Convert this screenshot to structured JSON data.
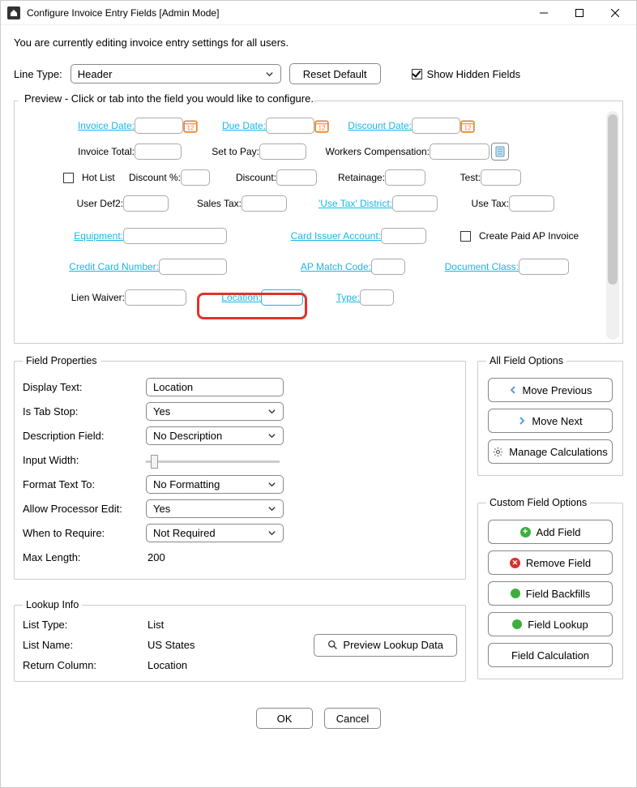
{
  "window": {
    "title": "Configure Invoice Entry Fields [Admin Mode]"
  },
  "intro": "You are currently editing invoice entry settings for all users.",
  "row1": {
    "line_type_label": "Line Type:",
    "line_type_value": "Header",
    "reset_label": "Reset Default",
    "show_hidden_label": "Show Hidden Fields",
    "show_hidden_checked": true
  },
  "preview": {
    "legend": "Preview - Click or tab into the field you would like to configure.",
    "fields": {
      "invoice_date": "Invoice Date:",
      "due_date": "Due Date:",
      "discount_date": "Discount Date:",
      "invoice_total": "Invoice Total:",
      "set_to_pay": "Set to Pay:",
      "workers_comp": "Workers Compensation:",
      "hot_list": "Hot List",
      "discount_pct": "Discount %:",
      "discount": "Discount:",
      "retainage": "Retainage:",
      "test": "Test:",
      "user_def2": "User Def2:",
      "sales_tax": "Sales Tax:",
      "use_tax_district": "'Use Tax' District:",
      "use_tax": "Use Tax:",
      "equipment": "Equipment:",
      "card_issuer": "Card Issuer Account:",
      "create_paid": "Create Paid AP Invoice",
      "cc_number": "Credit Card Number:",
      "ap_match": "AP Match Code:",
      "doc_class": "Document Class:",
      "lien_waiver": "Lien Waiver:",
      "location": "Location:",
      "type": "Type:"
    }
  },
  "field_props": {
    "legend": "Field Properties",
    "display_text_label": "Display Text:",
    "display_text_value": "Location",
    "is_tab_stop_label": "Is Tab Stop:",
    "is_tab_stop_value": "Yes",
    "desc_field_label": "Description Field:",
    "desc_field_value": "No Description",
    "input_width_label": "Input Width:",
    "format_text_label": "Format Text To:",
    "format_text_value": "No Formatting",
    "allow_proc_label": "Allow Processor Edit:",
    "allow_proc_value": "Yes",
    "when_require_label": "When to Require:",
    "when_require_value": "Not Required",
    "max_length_label": "Max Length:",
    "max_length_value": "200"
  },
  "all_field_options": {
    "legend": "All Field Options",
    "move_prev": "Move Previous",
    "move_next": "Move Next",
    "manage_calc": "Manage Calculations"
  },
  "custom_field_options": {
    "legend": "Custom Field Options",
    "add_field": "Add Field",
    "remove_field": "Remove Field",
    "field_backfills": "Field Backfills",
    "field_lookup": "Field Lookup",
    "field_calc": "Field Calculation"
  },
  "lookup": {
    "legend": "Lookup Info",
    "list_type_label": "List Type:",
    "list_type_value": "List",
    "list_name_label": "List Name:",
    "list_name_value": "US States",
    "return_col_label": "Return Column:",
    "return_col_value": "Location",
    "preview_btn": "Preview Lookup Data"
  },
  "footer": {
    "ok": "OK",
    "cancel": "Cancel"
  }
}
